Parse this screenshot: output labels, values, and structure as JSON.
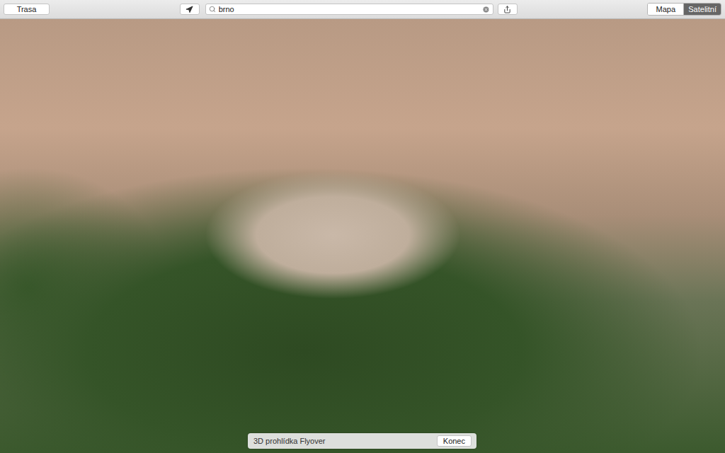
{
  "toolbar": {
    "route_button": "Trasa",
    "search": {
      "value": "brno"
    },
    "view_modes": [
      {
        "label": "Mapa",
        "selected": false
      },
      {
        "label": "Satelitní",
        "selected": true
      }
    ]
  },
  "flyover_bar": {
    "title": "3D prohlídka Flyover",
    "button": "Konec"
  }
}
